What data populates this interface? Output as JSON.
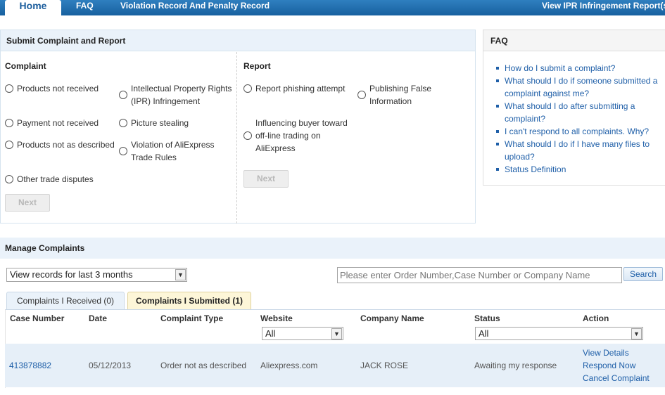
{
  "nav": {
    "home": "Home",
    "faq": "FAQ",
    "violation": "Violation Record And Penalty Record",
    "ipr": "View IPR Infringement Report(s)"
  },
  "submit": {
    "title": "Submit Complaint and Report",
    "complaint_title": "Complaint",
    "complaint_options": [
      "Products not received",
      "Intellectual Property Rights (IPR) Infringement",
      "Payment not received",
      "Picture stealing",
      "Products not as described",
      "Violation of AliExpress Trade Rules",
      "Other trade disputes"
    ],
    "report_title": "Report",
    "report_options": [
      "Report phishing attempt",
      "Publishing False Information",
      "Influencing buyer toward off-line trading on AliExpress"
    ],
    "next_label": "Next"
  },
  "faq": {
    "title": "FAQ",
    "items": [
      "How do I submit a complaint?",
      "What should I do if someone submitted a complaint against me?",
      "What should I do after submitting a complaint?",
      "I can't respond to all complaints. Why?",
      "What should I do if I have many files to upload?",
      "Status Definition"
    ]
  },
  "manage": {
    "title": "Manage Complaints",
    "period_selected": "View records for last 3 months",
    "search_placeholder": "Please enter Order Number,Case Number or Company Name",
    "search_label": "Search",
    "tabs": [
      "Complaints I Received (0)",
      "Complaints I Submitted (1)"
    ],
    "columns": [
      "Case Number",
      "Date",
      "Complaint Type",
      "Website",
      "Company Name",
      "Status",
      "Action"
    ],
    "website_filter": "All",
    "status_filter": "All",
    "rows": [
      {
        "case_number": "413878882",
        "date": "05/12/2013",
        "complaint_type": "Order not as described",
        "website": "Aliexpress.com",
        "company": "JACK ROSE",
        "status": "Awaiting my response",
        "actions": [
          "View Details",
          "Respond Now",
          "Cancel Complaint"
        ]
      }
    ]
  },
  "colors": {
    "nav_blue": "#17609f",
    "link_blue": "#1f5fa8",
    "header_bg": "#eaf2fa",
    "active_tab_bg": "#fdf6d8"
  }
}
